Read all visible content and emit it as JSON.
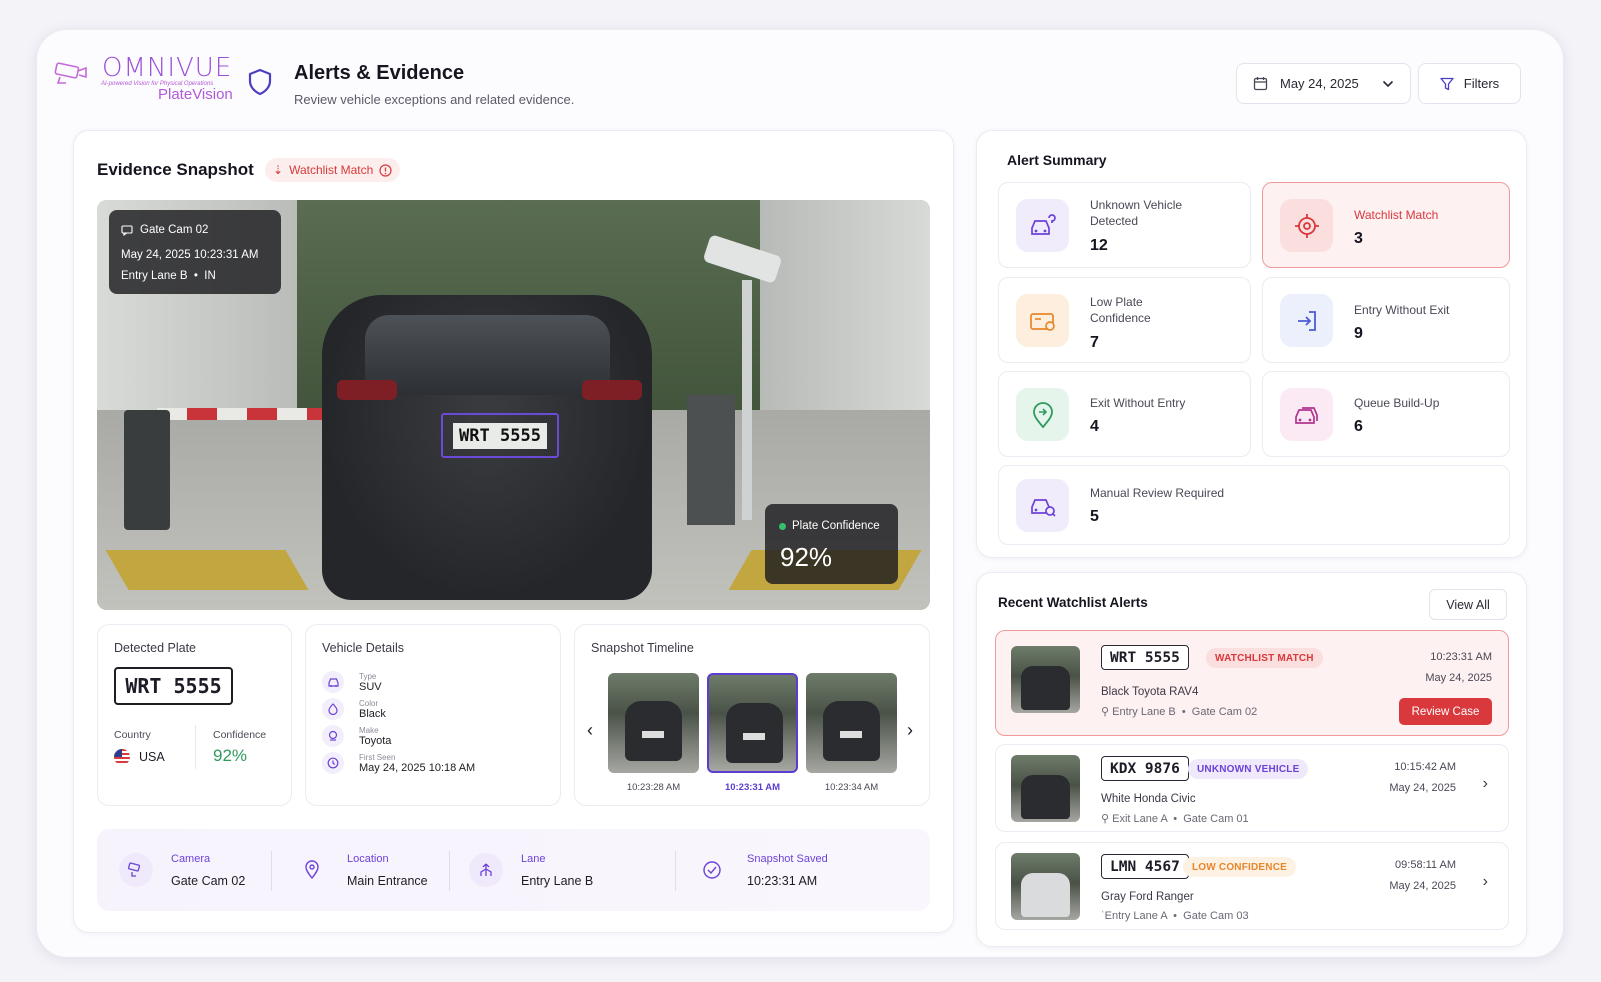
{
  "brand": {
    "name": "OMNIVUE",
    "tagline": "AI-powered Vision for Physical Operations",
    "product": "PlateVision"
  },
  "header": {
    "title": "Alerts & Evidence",
    "subtitle": "Review vehicle exceptions and related evidence.",
    "date": "May 24, 2025",
    "filters_label": "Filters"
  },
  "evidence": {
    "title": "Evidence Snapshot",
    "chip": "Watchlist Match",
    "camera": "Gate Cam 02",
    "timestamp": "May 24, 2025 10:23:31 AM",
    "lane": "Entry Lane B",
    "direction": "IN",
    "plate_in_image": "WRT 5555",
    "confidence_label": "Plate Confidence",
    "confidence_value": "92%"
  },
  "detected_plate": {
    "title": "Detected Plate",
    "plate": "WRT 5555",
    "country_label": "Country",
    "country": "USA",
    "confidence_label": "Confidence",
    "confidence": "92%"
  },
  "vehicle_details": {
    "title": "Vehicle Details",
    "rows": [
      {
        "key": "Type",
        "value": "SUV"
      },
      {
        "key": "Color",
        "value": "Black"
      },
      {
        "key": "Make",
        "value": "Toyota"
      },
      {
        "key": "First Seen",
        "value": "May 24, 2025 10:18 AM"
      }
    ]
  },
  "timeline": {
    "title": "Snapshot Timeline",
    "frames": [
      {
        "time": "10:23:28 AM",
        "plate": "WRT 5555"
      },
      {
        "time": "10:23:31 AM",
        "plate": "WRT 5555"
      },
      {
        "time": "10:23:34 AM",
        "plate": "WRT 5555"
      }
    ]
  },
  "info_strip": [
    {
      "label": "Camera",
      "value": "Gate Cam 02"
    },
    {
      "label": "Location",
      "value": "Main Entrance"
    },
    {
      "label": "Lane",
      "value": "Entry Lane B"
    },
    {
      "label": "Snapshot Saved",
      "value": "10:23:31 AM"
    }
  ],
  "summary": {
    "title": "Alert Summary",
    "items": [
      {
        "label": "Unknown Vehicle Detected",
        "value": "12",
        "color": "#6b43d6"
      },
      {
        "label": "Watchlist Match",
        "value": "3",
        "color": "#d9383c"
      },
      {
        "label": "Low Plate Confidence",
        "value": "7",
        "color": "#e8862b"
      },
      {
        "label": "Entry Without Exit",
        "value": "9",
        "color": "#4b5bd6"
      },
      {
        "label": "Exit Without Entry",
        "value": "4",
        "color": "#2f9a5e"
      },
      {
        "label": "Queue Build-Up",
        "value": "6",
        "color": "#b2358f"
      },
      {
        "label": "Manual Review Required",
        "value": "5",
        "color": "#6b43d6"
      }
    ]
  },
  "recent": {
    "title": "Recent Watchlist Alerts",
    "view_all": "View All",
    "review_label": "Review Case",
    "items": [
      {
        "plate": "WRT 5555",
        "badge": "WATCHLIST MATCH",
        "model": "Black Toyota RAV4",
        "lane": "Entry Lane B",
        "camera": "Gate Cam 02",
        "time": "10:23:31 AM",
        "date": "May 24, 2025"
      },
      {
        "plate": "KDX 9876",
        "badge": "UNKNOWN VEHICLE",
        "model": "White Honda Civic",
        "lane": "Exit Lane A",
        "camera": "Gate Cam 01",
        "time": "10:15:42 AM",
        "date": "May 24, 2025"
      },
      {
        "plate": "LMN 4567",
        "badge": "LOW CONFIDENCE",
        "model": "Gray Ford Ranger",
        "lane": "Entry Lane A",
        "camera": "Gate Cam 03",
        "time": "09:58:11 AM",
        "date": "May 24, 2025"
      }
    ]
  },
  "colors": {
    "accent": "#6b43d6",
    "alert": "#d9383c",
    "success": "#2f9a5e",
    "warning": "#e8862b"
  }
}
